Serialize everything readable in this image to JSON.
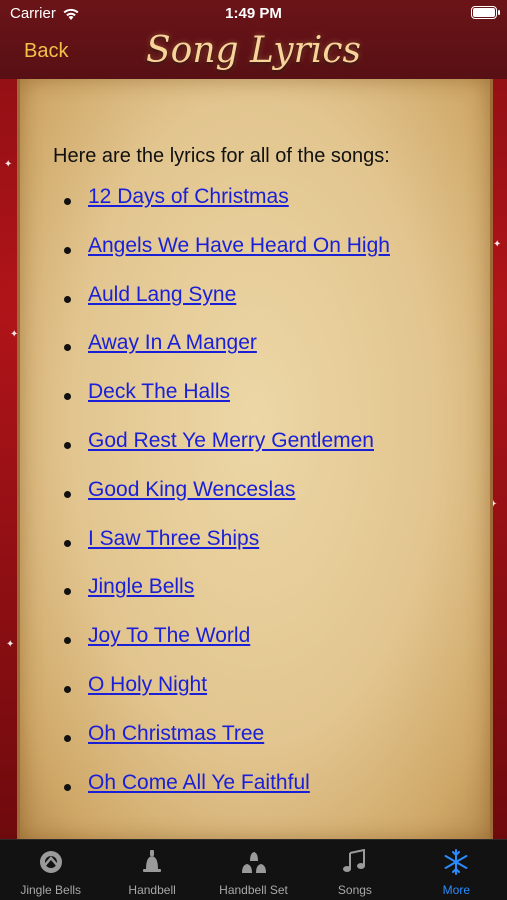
{
  "status": {
    "carrier": "Carrier",
    "time": "1:49 PM"
  },
  "nav": {
    "back_label": "Back",
    "title": "Song Lyrics"
  },
  "content": {
    "intro": "Here are the lyrics for all of the songs:",
    "songs": [
      "12 Days of Christmas",
      "Angels We Have Heard On High",
      "Auld Lang Syne",
      "Away In A Manger",
      "Deck The Halls",
      "God Rest Ye Merry Gentlemen",
      "Good King Wenceslas",
      "I Saw Three Ships",
      "Jingle Bells",
      "Joy To The World",
      "O Holy Night",
      "Oh Christmas Tree",
      "Oh Come All Ye Faithful"
    ]
  },
  "tabbar": {
    "tabs": [
      {
        "label": "Jingle Bells",
        "icon": "jingle-bell-icon"
      },
      {
        "label": "Handbell",
        "icon": "handbell-icon"
      },
      {
        "label": "Handbell Set",
        "icon": "handbell-set-icon"
      },
      {
        "label": "Songs",
        "icon": "music-notes-icon"
      },
      {
        "label": "More",
        "icon": "snowflake-icon"
      }
    ],
    "active_color": "#2a8cff"
  }
}
